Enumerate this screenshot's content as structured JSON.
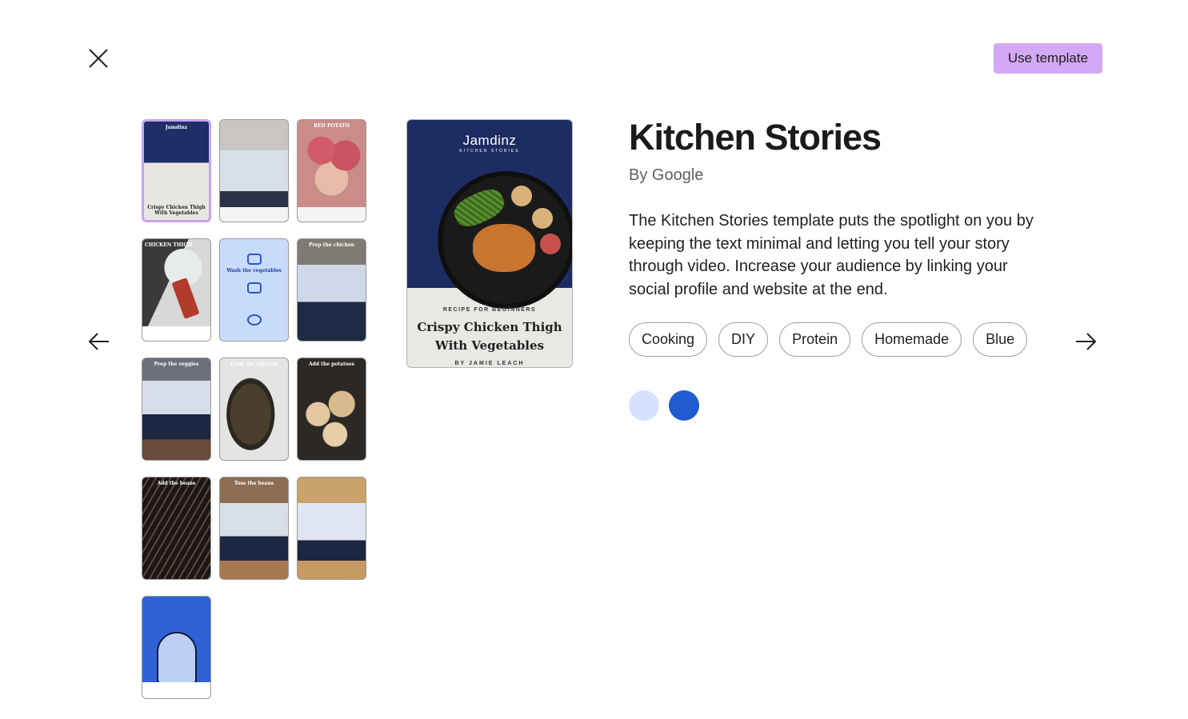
{
  "toolbar": {
    "use_template_label": "Use template"
  },
  "icons": {
    "close": "close-icon",
    "prev": "arrow-left-icon",
    "next": "arrow-right-icon"
  },
  "thumbnails": [
    {
      "label": "Jamdinz",
      "caption": "Crispy Chicken Thigh With Vegetables"
    },
    {
      "label": ""
    },
    {
      "label": "RED POTATO"
    },
    {
      "label": "CHICKEN THIGH"
    },
    {
      "label": "Wash the vegetables"
    },
    {
      "label": "Prep the chicken"
    },
    {
      "label": "Prep the veggies"
    },
    {
      "label": "Cook the chicken"
    },
    {
      "label": "Add the potatoes"
    },
    {
      "label": "Add the beans"
    },
    {
      "label": "Toss the beans"
    },
    {
      "label": ""
    },
    {
      "label": ""
    }
  ],
  "cover": {
    "brand": "Jamdinz",
    "subtitle": "KITCHEN STORIES",
    "kicker": "RECIPE FOR BEGINNERS",
    "title": "Crispy Chicken Thigh With Vegetables",
    "author": "BY JAMIE LEACH"
  },
  "template": {
    "title": "Kitchen Stories",
    "byline": "By Google",
    "description": "The Kitchen Stories template puts the spotlight on you by keeping the text minimal and letting you tell your story through video. Increase your audience by linking your social profile and website at the end."
  },
  "tags": [
    "Cooking",
    "DIY",
    "Protein",
    "Homemade",
    "Blue"
  ],
  "colors": {
    "accent_button": "#d3a8f4",
    "swatch_light": "#d6e2fb",
    "swatch_dark": "#1f5bd1"
  }
}
